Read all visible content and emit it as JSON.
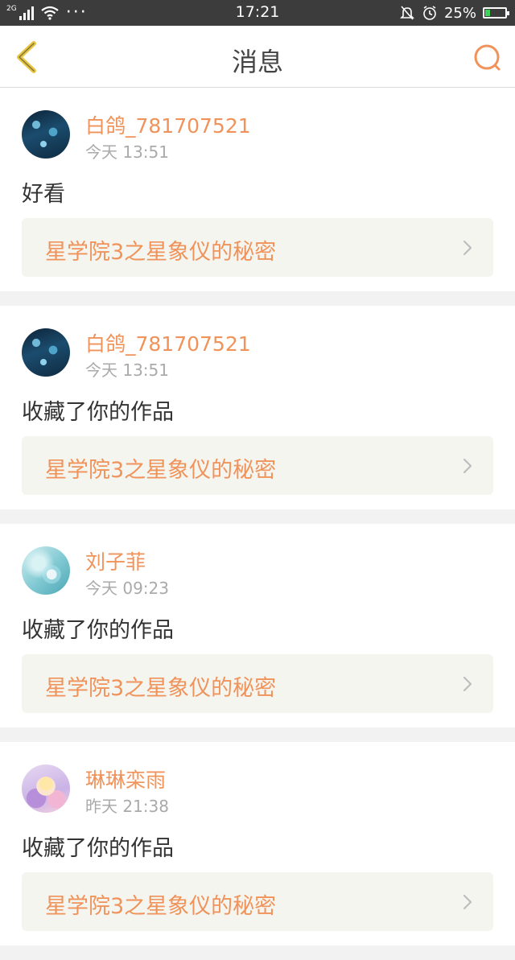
{
  "status_bar": {
    "network": "2G",
    "more": "···",
    "time": "17:21",
    "battery_text": "25%",
    "battery_level": 0.25,
    "icons": [
      "signal-icon",
      "wifi-icon",
      "alarm-muted-icon",
      "clock-icon",
      "battery-icon"
    ]
  },
  "header": {
    "title": "消息",
    "back_icon": "chevron-left-icon",
    "search_icon": "search-icon"
  },
  "colors": {
    "accent": "#f0935a",
    "back_icon": "#e8c640",
    "card_bg": "#ffffff",
    "page_bg": "#f2f2f2",
    "link_bg": "#f5f5f0"
  },
  "messages": [
    {
      "user": "白鸽_781707521",
      "time": "今天 13:51",
      "text": "好看",
      "work": "星学院3之星象仪的秘密"
    },
    {
      "user": "白鸽_781707521",
      "time": "今天 13:51",
      "text": "收藏了你的作品",
      "work": "星学院3之星象仪的秘密"
    },
    {
      "user": "刘子菲",
      "time": "今天 09:23",
      "text": "收藏了你的作品",
      "work": "星学院3之星象仪的秘密"
    },
    {
      "user": "琳琳栾雨",
      "time": "昨天 21:38",
      "text": "收藏了你的作品",
      "work": "星学院3之星象仪的秘密"
    }
  ]
}
